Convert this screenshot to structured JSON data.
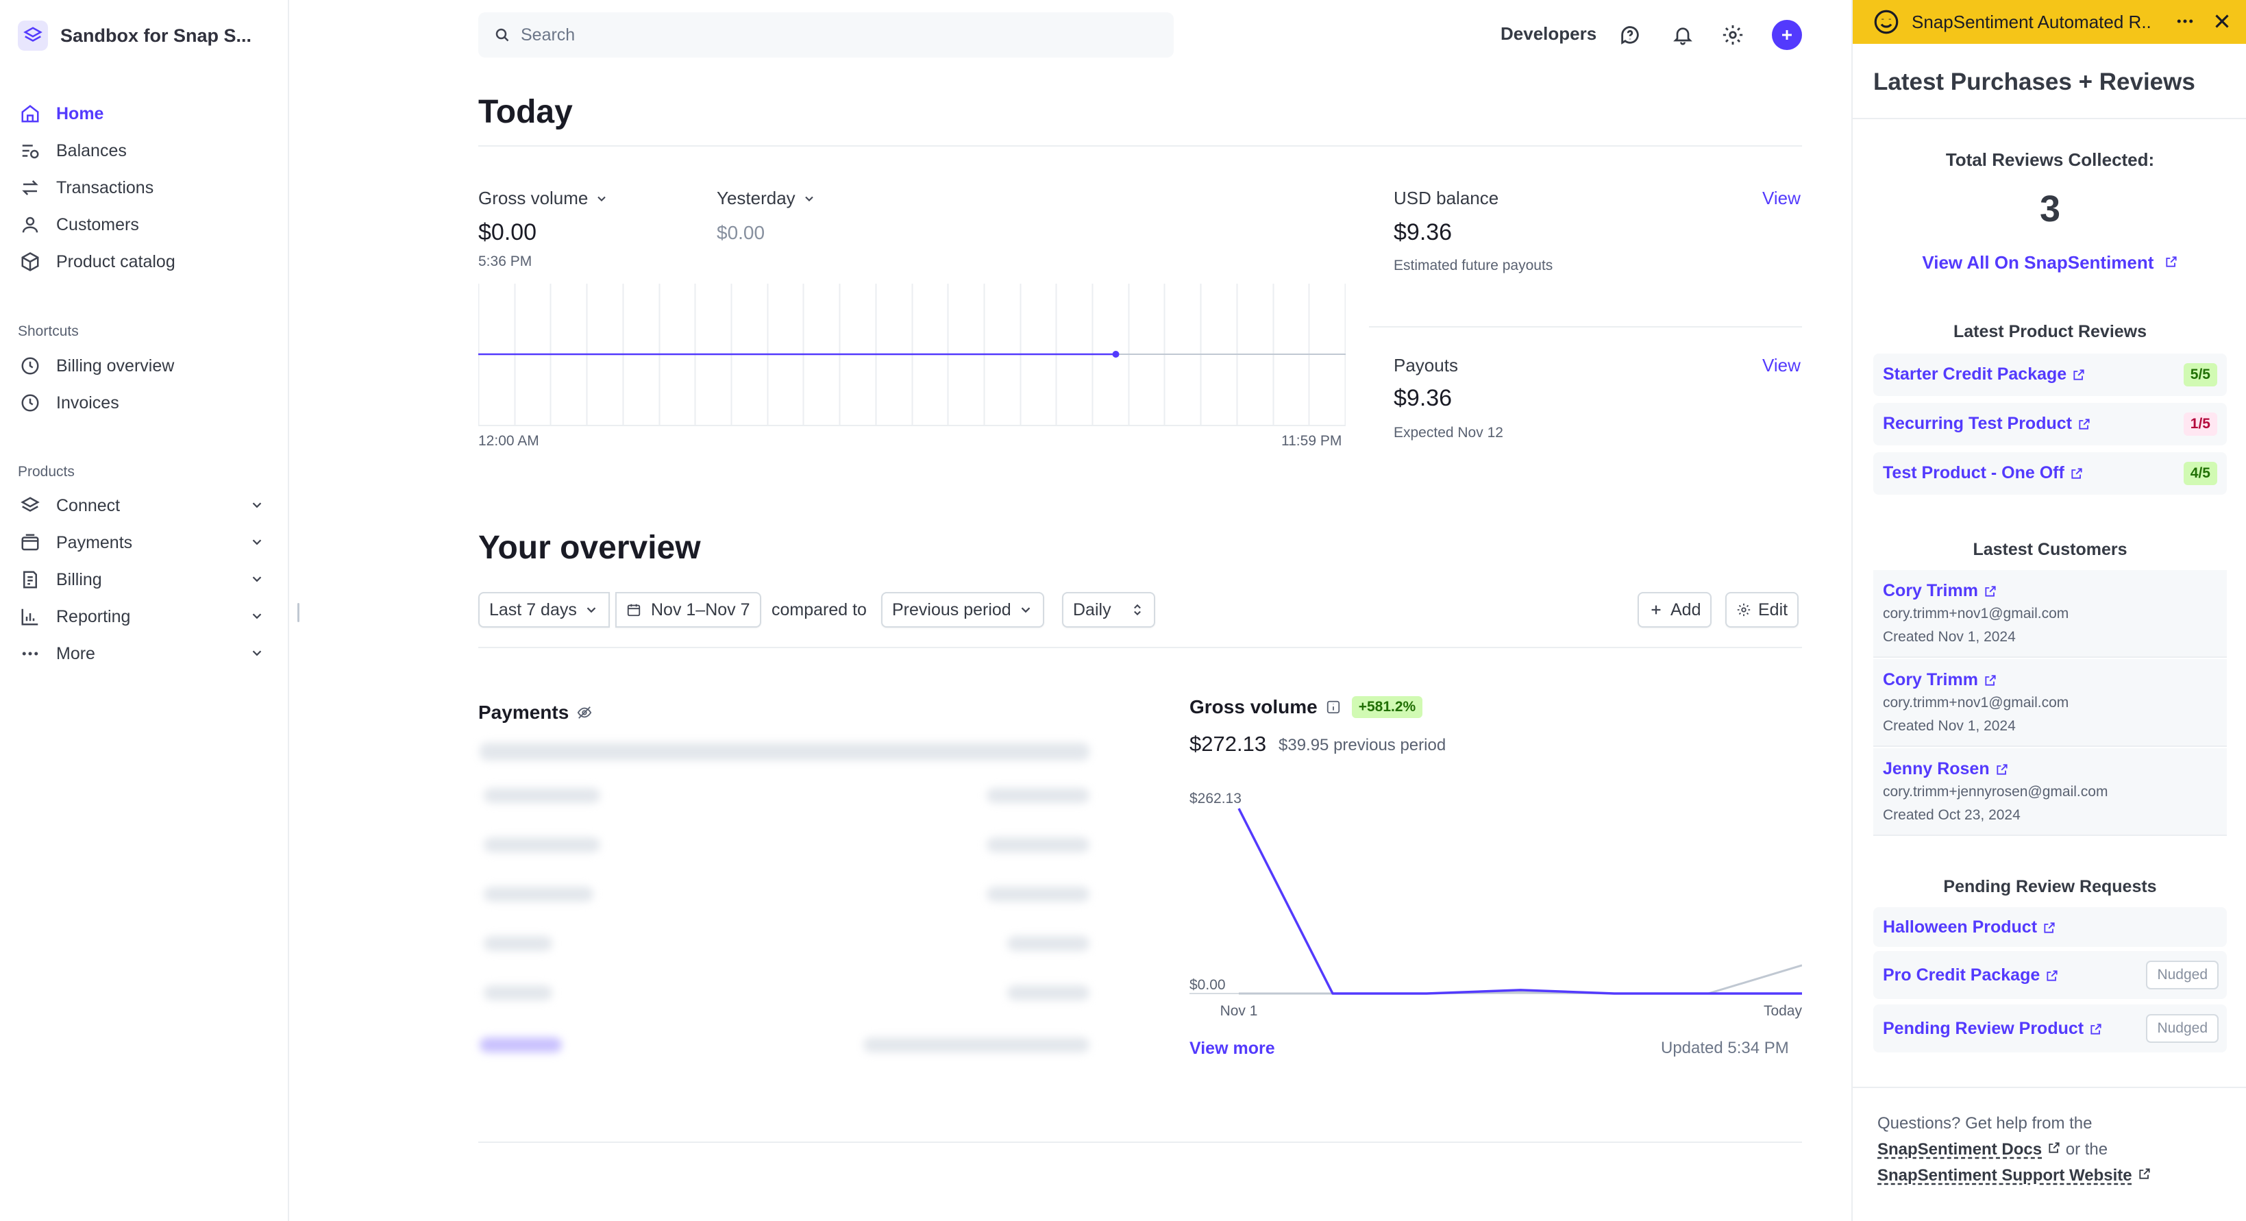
{
  "sidebar": {
    "account_name": "Sandbox for Snap S...",
    "nav": [
      {
        "label": "Home",
        "icon": "home-icon",
        "active": true
      },
      {
        "label": "Balances",
        "icon": "balances-icon"
      },
      {
        "label": "Transactions",
        "icon": "transactions-icon"
      },
      {
        "label": "Customers",
        "icon": "customers-icon"
      },
      {
        "label": "Product catalog",
        "icon": "product-catalog-icon"
      }
    ],
    "shortcuts_label": "Shortcuts",
    "shortcuts": [
      {
        "label": "Billing overview",
        "icon": "clock-icon"
      },
      {
        "label": "Invoices",
        "icon": "clock-icon"
      }
    ],
    "products_label": "Products",
    "products": [
      {
        "label": "Connect",
        "icon": "connect-icon"
      },
      {
        "label": "Payments",
        "icon": "payments-icon"
      },
      {
        "label": "Billing",
        "icon": "billing-icon"
      },
      {
        "label": "Reporting",
        "icon": "reporting-icon"
      },
      {
        "label": "More",
        "icon": "more-dots-icon"
      }
    ]
  },
  "topbar": {
    "search_placeholder": "Search",
    "developers_label": "Developers"
  },
  "today": {
    "title": "Today",
    "gross_volume_label": "Gross volume",
    "gross_volume_value": "$0.00",
    "gross_volume_time": "5:36 PM",
    "yesterday_label": "Yesterday",
    "yesterday_value": "$0.00",
    "chart_start": "12:00 AM",
    "chart_end": "11:59 PM",
    "progress_fraction": 0.735,
    "usd_balance_label": "USD balance",
    "usd_balance_value": "$9.36",
    "usd_balance_note": "Estimated future payouts",
    "payouts_label": "Payouts",
    "payouts_value": "$9.36",
    "payouts_note": "Expected Nov 12",
    "view_label": "View"
  },
  "overview": {
    "title": "Your overview",
    "range": "Last 7 days",
    "dates": "Nov 1–Nov 7",
    "compared_to": "compared to",
    "comparison": "Previous period",
    "interval": "Daily",
    "add_label": "Add",
    "edit_label": "Edit",
    "payments_title": "Payments",
    "gross_volume_title": "Gross volume",
    "gross_volume_change": "+581.2%",
    "gross_volume_value": "$272.13",
    "gross_volume_previous": "$39.95 previous period",
    "view_more": "View more",
    "updated": "Updated 5:34 PM",
    "colors": {
      "accent": "#533afd",
      "positive_bg": "#d1fab3",
      "positive_fg": "#217005"
    }
  },
  "chart_data": {
    "type": "line",
    "ylabel_top": "$262.13",
    "ylabel_bottom": "$0.00",
    "x_start_label": "Nov 1",
    "x_end_label": "Today",
    "ylim": [
      0,
      262.13
    ],
    "series": [
      {
        "values": [
          262.13,
          0,
          0,
          5,
          0,
          0,
          0
        ]
      },
      {
        "values": [
          0,
          0,
          0,
          2,
          0,
          0,
          39.95
        ]
      }
    ]
  },
  "panel": {
    "header_title": "SnapSentiment Automated R...",
    "title": "Latest Purchases + Reviews",
    "total_label": "Total Reviews Collected:",
    "total_value": "3",
    "view_all": "View All On SnapSentiment",
    "reviews_title": "Latest Product Reviews",
    "reviews": [
      {
        "name": "Starter Credit Package",
        "score": "5/5",
        "tone": "good"
      },
      {
        "name": "Recurring Test Product",
        "score": "1/5",
        "tone": "bad"
      },
      {
        "name": "Test Product - One Off",
        "score": "4/5",
        "tone": "good"
      }
    ],
    "customers_title": "Lastest Customers",
    "customers": [
      {
        "name": "Cory Trimm",
        "email": "cory.trimm+nov1@gmail.com",
        "created": "Created Nov 1, 2024"
      },
      {
        "name": "Cory Trimm",
        "email": "cory.trimm+nov1@gmail.com",
        "created": "Created Nov 1, 2024"
      },
      {
        "name": "Jenny Rosen",
        "email": "cory.trimm+jennyrosen@gmail.com",
        "created": "Created Oct 23, 2024"
      }
    ],
    "pending_title": "Pending Review Requests",
    "pending": [
      {
        "name": "Halloween Product",
        "status": ""
      },
      {
        "name": "Pro Credit Package",
        "status": "Nudged"
      },
      {
        "name": "Pending Review Product",
        "status": "Nudged"
      }
    ],
    "footer_text1": "Questions? Get help from the",
    "footer_docs": "SnapSentiment Docs",
    "footer_or": "or the",
    "footer_support": "SnapSentiment Support Website"
  }
}
